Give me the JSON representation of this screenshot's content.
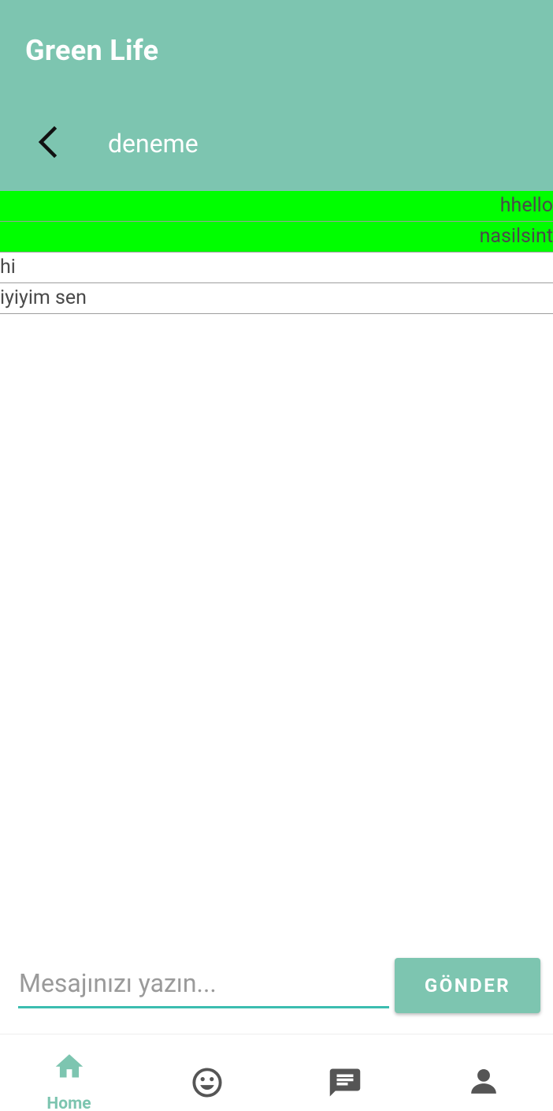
{
  "app": {
    "title": "Green Life"
  },
  "chat": {
    "title": "deneme"
  },
  "messages": [
    {
      "text": "hhello",
      "direction": "sent"
    },
    {
      "text": "nasilsint",
      "direction": "sent"
    },
    {
      "text": "hi",
      "direction": "received"
    },
    {
      "text": "iyiyim sen",
      "direction": "received"
    }
  ],
  "composer": {
    "placeholder": "Mesajınızı yazın...",
    "value": "",
    "send_label": "GÖNDER"
  },
  "nav": {
    "items": [
      {
        "id": "home",
        "label": "Home",
        "icon": "home-icon",
        "active": true
      },
      {
        "id": "mood",
        "label": "",
        "icon": "smiley-icon",
        "active": false
      },
      {
        "id": "chat",
        "label": "",
        "icon": "chat-icon",
        "active": false
      },
      {
        "id": "profile",
        "label": "",
        "icon": "person-icon",
        "active": false
      }
    ]
  },
  "colors": {
    "primary": "#7dc5b0",
    "sent_bubble": "#00ff00",
    "input_underline": "#3cbdb0",
    "nav_inactive": "#555555"
  }
}
